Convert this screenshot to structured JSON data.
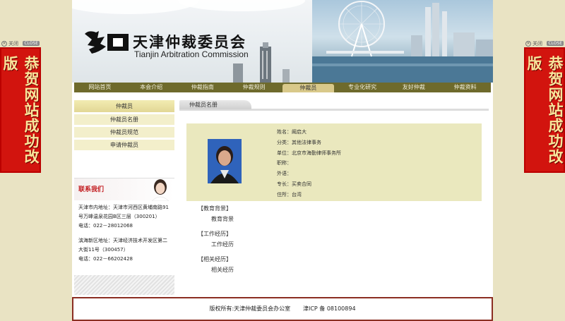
{
  "side_ads": {
    "close_label": "关闭",
    "tag": "CLOSE",
    "text": "恭贺网站成功改版"
  },
  "header": {
    "org_name_cn": "天津仲裁委员会",
    "org_name_en": "Tianjin Arbitration Commission"
  },
  "nav": {
    "items": [
      "网站首页",
      "本会介绍",
      "仲裁指南",
      "仲裁规则",
      "仲裁员",
      "专业化研究",
      "友好仲裁",
      "仲裁资料"
    ],
    "active_index": 4
  },
  "sidebar": {
    "heading": "仲裁员",
    "links": [
      "仲裁员名册",
      "仲裁员规范",
      "申请仲裁员"
    ]
  },
  "contact": {
    "title": "联系我们",
    "city_address": "天津市内地址：天津市河西区黄埔南路91号万峰温泉花园B区三层（300201）",
    "city_phone": "电话：022－28012068",
    "binhai_address": "滨海新区地址：天津经济技术开发区第二大街11号（300457）",
    "binhai_phone": "电话：022－66202428"
  },
  "section": {
    "title": "仲裁员名册"
  },
  "profile": {
    "name": "姓名：阚启大",
    "category": "分类：其他法律事务",
    "employer": "单位：北京市海勤律师事务所",
    "title": "职称：",
    "foreign_lang": "外语：",
    "specialty": "专长：买卖合同",
    "residence": "住所：台湾"
  },
  "cv": {
    "education_head": "【教育背景】",
    "education_body": "教育背景",
    "work_head": "【工作经历】",
    "work_body": "工作经历",
    "related_head": "【相关经历】",
    "related_body": "相关经历"
  },
  "footer": {
    "copyright": "版权所有:天津仲裁委员会办公室",
    "icp": "津ICP 备 08100894"
  },
  "colors": {
    "nav_bg": "#6e6a2c",
    "card_bg": "#eae8be",
    "ad_red": "#d2140e",
    "footer_border": "#8b2e22"
  }
}
